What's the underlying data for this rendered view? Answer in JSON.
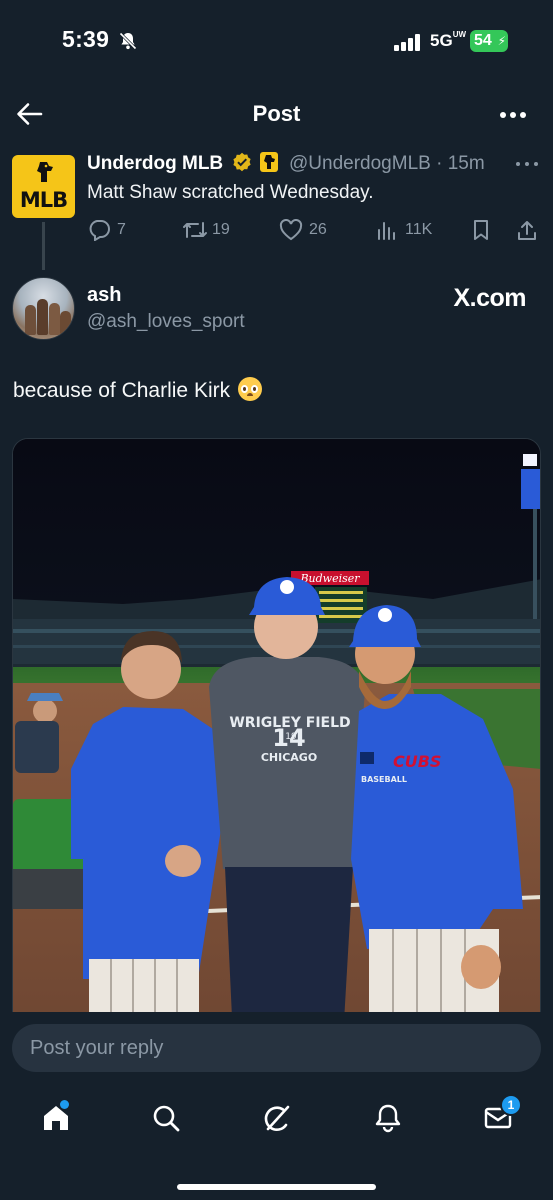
{
  "status_bar": {
    "time": "5:39",
    "network": "5G",
    "network_suffix": "UW",
    "battery": "54",
    "icons": [
      "bell-slash-icon",
      "signal-bars-icon",
      "battery-charging-icon"
    ]
  },
  "header": {
    "title": "Post",
    "back_icon": "arrow-left-icon",
    "more_icon": "more-horizontal-icon"
  },
  "quoted_tweet": {
    "avatar_text": "MLB",
    "author_name": "Underdog MLB",
    "handle_time": "@UnderdogMLB · 15m",
    "text": "Matt Shaw scratched Wednesday.",
    "actions": {
      "replies": "7",
      "retweets": "19",
      "likes": "26",
      "views": "11K"
    }
  },
  "post": {
    "author_name": "ash",
    "author_handle": "@ash_loves_sport",
    "watermark": "X.com",
    "text": "because of Charlie Kirk",
    "emoji": "pleading-face-emoji",
    "photo": {
      "sign_brand": "Budweiser",
      "shirt_line1": "WRIGLEY FIELD",
      "shirt_number": "14",
      "shirt_year": "19",
      "shirt_line2": "CHICAGO",
      "jersey_text": "CUBS",
      "jersey_sub": "BASEBALL"
    }
  },
  "reply": {
    "placeholder": "Post your reply"
  },
  "tabbar": {
    "items": [
      "home-icon",
      "search-icon",
      "grok-icon",
      "notifications-icon",
      "messages-icon"
    ],
    "messages_badge": "1"
  },
  "colors": {
    "background": "#15202b",
    "muted_text": "#8b98a5",
    "accent": "#1d9bf0",
    "underdog_yellow": "#f5c518",
    "cubs_blue": "#2a5bd7"
  }
}
